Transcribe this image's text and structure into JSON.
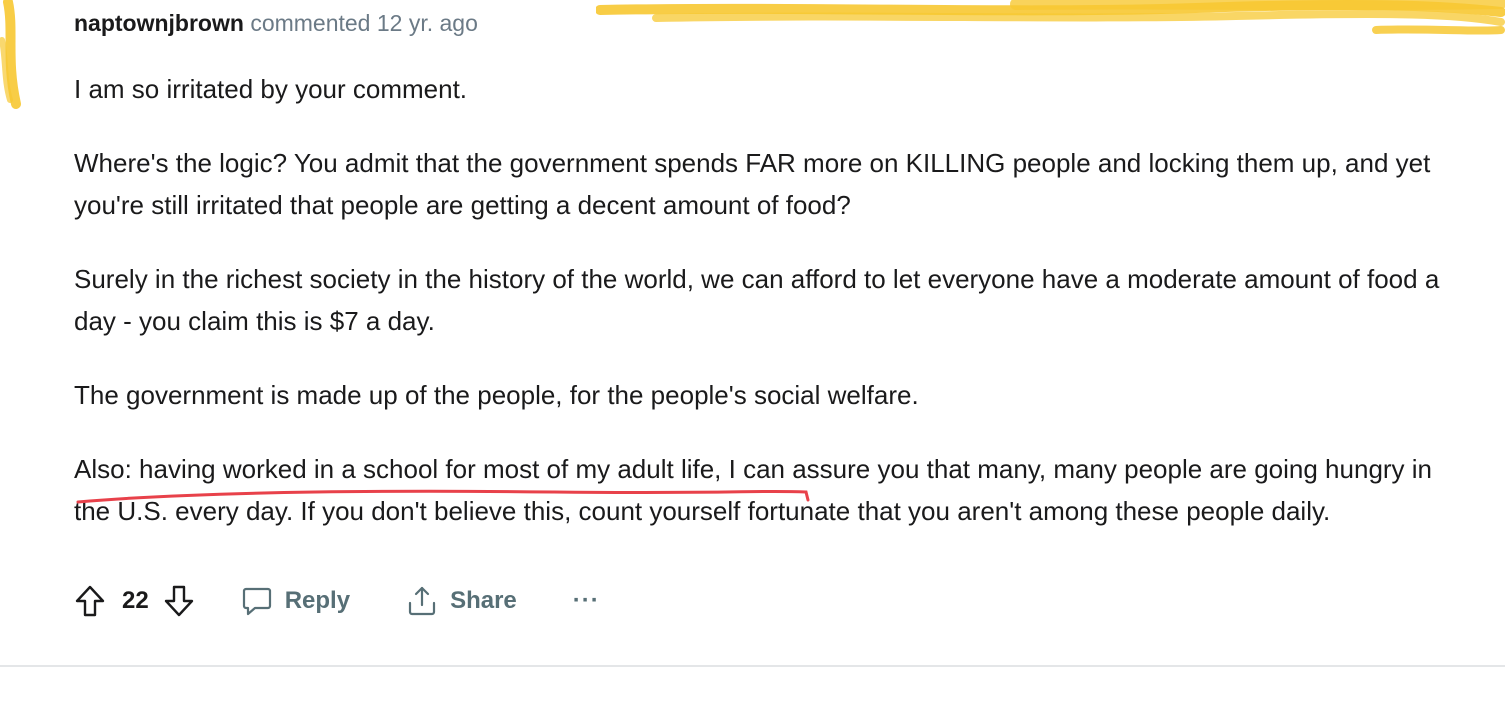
{
  "comment": {
    "author": "naptownjbrown",
    "meta_text": "commented 12 yr. ago",
    "paragraphs": [
      "I am so irritated by your comment.",
      "Where's the logic? You admit that the government spends FAR more on KILLING people and locking them up, and yet you're still irritated that people are getting a decent amount of food?",
      "Surely in the richest society in the history of the world, we can afford to let everyone have a moderate amount of food a day - you claim this is $7 a day.",
      "The government is made up of the people, for the people's social welfare.",
      "Also: having worked in a school for most of my adult life, I can assure you that many, many people are going hungry in the U.S. every day. If you don't believe this, count yourself fortunate that you aren't among these people daily."
    ]
  },
  "actions": {
    "score": "22",
    "reply_label": "Reply",
    "share_label": "Share",
    "more_label": "···"
  },
  "colors": {
    "highlighter": "#f7c832",
    "underline": "#e8414a",
    "meta_gray": "#6b7a86",
    "action_gray": "#576f76",
    "divider": "#e4e6e8"
  },
  "icons": {
    "upvote": "arrow-up-outline-icon",
    "downvote": "arrow-down-outline-icon",
    "reply": "speech-bubble-icon",
    "share": "share-upload-icon"
  }
}
